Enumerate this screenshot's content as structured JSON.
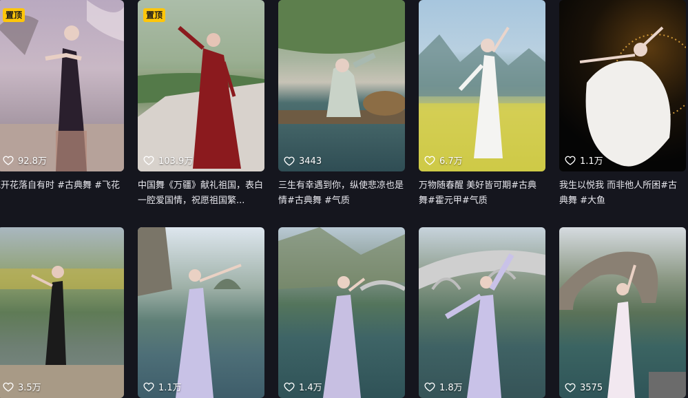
{
  "row1": [
    {
      "pinned": true,
      "pin_label": "置顶",
      "likes": "92.8万",
      "caption": "花开花落自有时 #古典舞 #飞花"
    },
    {
      "pinned": true,
      "pin_label": "置顶",
      "likes": "103.9万",
      "caption": "中国舞《万疆》献礼祖国，表白一腔爱国情，祝愿祖国繁..."
    },
    {
      "pinned": false,
      "likes": "3443",
      "caption": "三生有幸遇到你，纵使悲凉也是情#古典舞 #气质"
    },
    {
      "pinned": false,
      "likes": "6.7万",
      "caption": "万物随春醒 美好皆可期#古典舞#霍元甲#气质"
    },
    {
      "pinned": false,
      "likes": "1.1万",
      "caption": "我生以悦我 而非他人所困#古典舞 #大鱼"
    }
  ],
  "row2": [
    {
      "likes": "3.5万"
    },
    {
      "likes": "1.1万"
    },
    {
      "likes": "1.4万"
    },
    {
      "likes": "1.8万"
    },
    {
      "likes": "3575"
    }
  ]
}
